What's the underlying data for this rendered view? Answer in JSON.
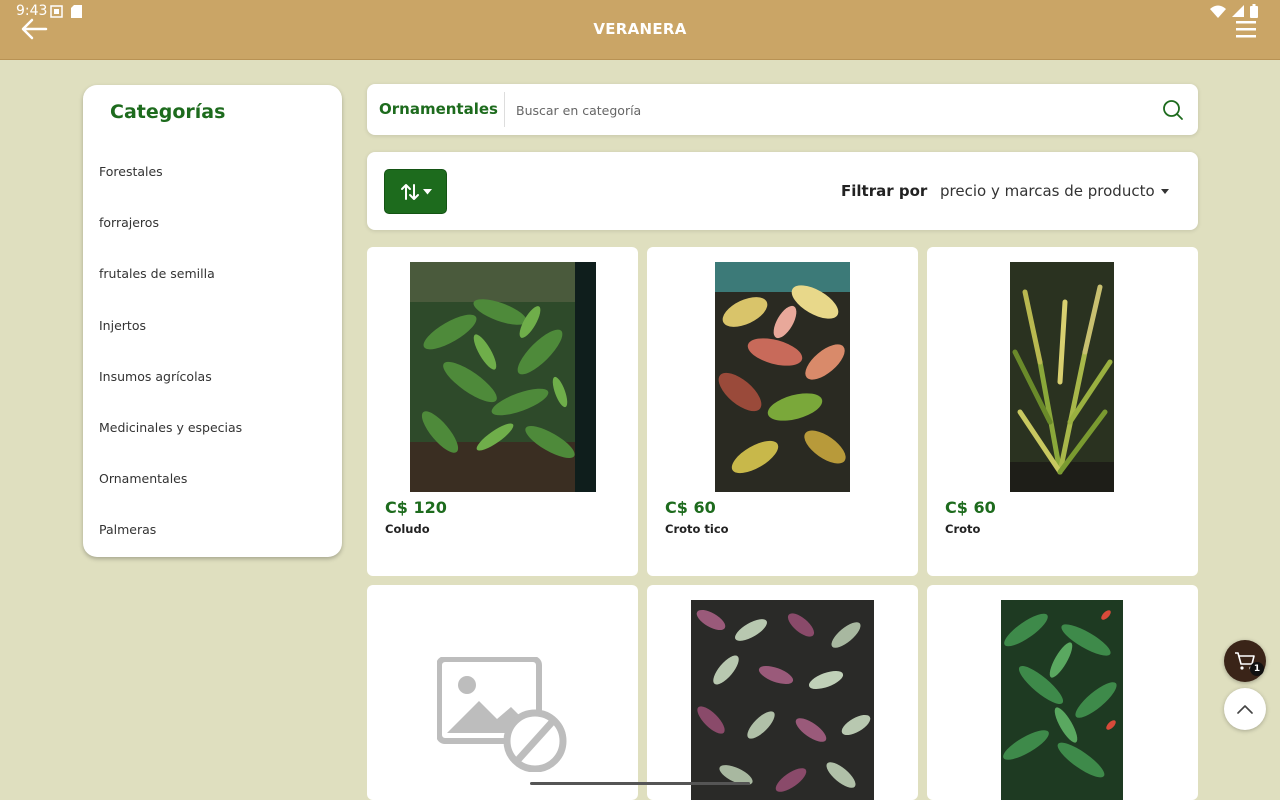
{
  "status_bar": {
    "time": "9:43"
  },
  "header": {
    "title": "VERANERA"
  },
  "sidebar": {
    "title": "Categorías",
    "items": [
      {
        "label": "Forestales"
      },
      {
        "label": "forrajeros"
      },
      {
        "label": "frutales de semilla"
      },
      {
        "label": "Injertos"
      },
      {
        "label": "Insumos agrícolas"
      },
      {
        "label": "Medicinales y especias"
      },
      {
        "label": "Ornamentales"
      },
      {
        "label": "Palmeras"
      }
    ]
  },
  "search": {
    "category": "Ornamentales",
    "placeholder": "Buscar en categoría",
    "value": ""
  },
  "filter": {
    "label": "Filtrar por",
    "selected": "precio y marcas de producto"
  },
  "products": [
    {
      "price": "C$ 120",
      "name": "Coludo"
    },
    {
      "price": "C$ 60",
      "name": "Croto tico"
    },
    {
      "price": "C$ 60",
      "name": "Croto"
    },
    {
      "price": "",
      "name": ""
    },
    {
      "price": "",
      "name": ""
    },
    {
      "price": "",
      "name": ""
    }
  ],
  "cart": {
    "count": "1"
  },
  "colors": {
    "header": "#caa566",
    "background": "#dfdfbf",
    "accent_green": "#1d6b1d",
    "cart_button": "#3a2418"
  },
  "icons": {
    "back": "arrow-left-icon",
    "menu": "hamburger-icon",
    "search": "search-icon",
    "sort": "sort-icon",
    "cart": "cart-icon",
    "scroll_top": "chevron-up-icon",
    "no_image": "image-unavailable-icon"
  }
}
